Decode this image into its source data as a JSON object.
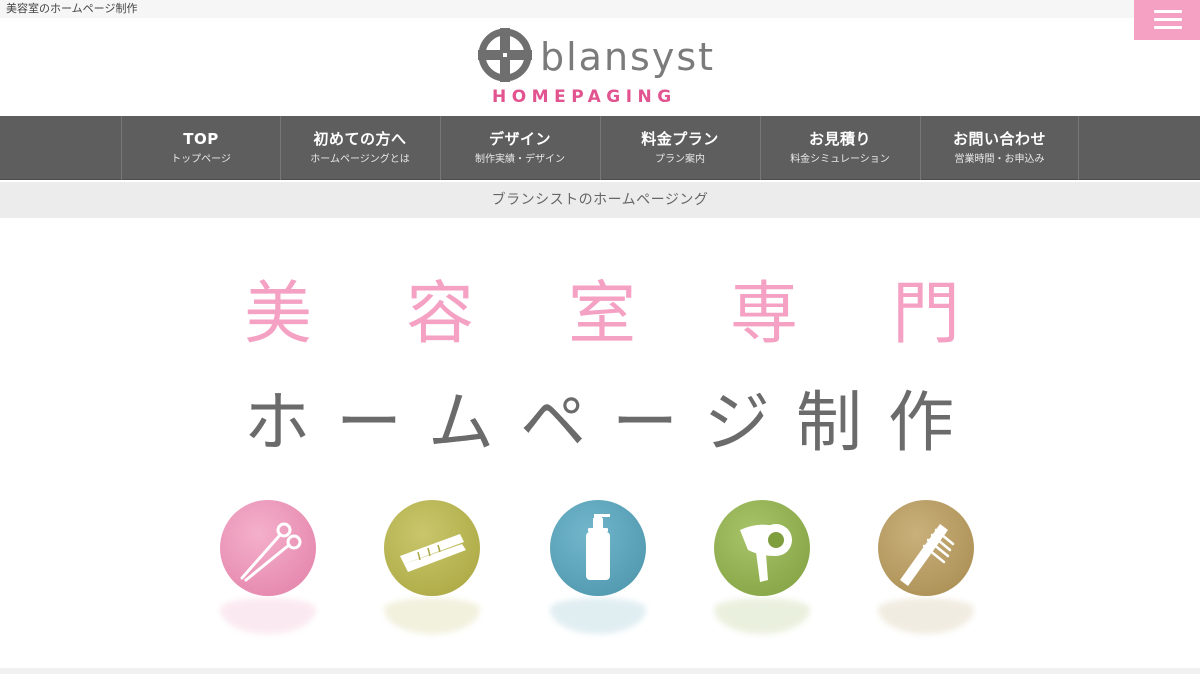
{
  "topbar": {
    "text": "美容室のホームページ制作"
  },
  "menu_button": {
    "icon": "hamburger-icon",
    "color": "#f4a1c3"
  },
  "logo": {
    "word": "blansyst",
    "sub": "HOMEPAGING",
    "mark_icon": "plus-circle-icon"
  },
  "nav": {
    "items": [
      {
        "main": "TOP",
        "sub": "トップページ"
      },
      {
        "main": "初めての方へ",
        "sub": "ホームページングとは"
      },
      {
        "main": "デザイン",
        "sub": "制作実績・デザイン"
      },
      {
        "main": "料金プラン",
        "sub": "プラン案内"
      },
      {
        "main": "お見積り",
        "sub": "料金シミュレーション"
      },
      {
        "main": "お問い合わせ",
        "sub": "営業時間・お申込み"
      }
    ]
  },
  "tagline": "ブランシストのホームページング",
  "hero": {
    "line1": [
      "美",
      "容",
      "室",
      "専",
      "門"
    ],
    "line2": [
      "ホ",
      "ー",
      "ム",
      "ペ",
      "ー",
      "ジ",
      "制",
      "作"
    ]
  },
  "icons": [
    {
      "name": "scissors-icon",
      "color": "#e98bb2"
    },
    {
      "name": "hair-iron-icon",
      "color": "#b6b34a"
    },
    {
      "name": "shampoo-bottle-icon",
      "color": "#58a1b8"
    },
    {
      "name": "hair-dryer-icon",
      "color": "#90ae4c"
    },
    {
      "name": "comb-icon",
      "color": "#b59a5e"
    }
  ],
  "colors": {
    "accent_pink": "#f4a1c3",
    "logo_pink": "#e2548f",
    "nav_bg": "#5e5e5e"
  }
}
